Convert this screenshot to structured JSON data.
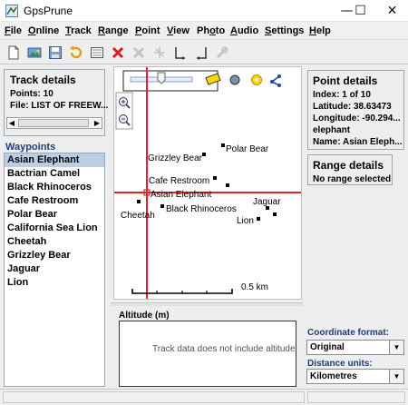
{
  "window": {
    "title": "GpsPrune",
    "minimize_glyph": "—",
    "maximize_glyph": "☐",
    "close_glyph": "✕"
  },
  "menu": {
    "items": [
      {
        "label": "File",
        "mnemonic": "F",
        "rest": "ile"
      },
      {
        "label": "Online",
        "mnemonic": "O",
        "rest": "nline"
      },
      {
        "label": "Track",
        "mnemonic": "T",
        "rest": "rack"
      },
      {
        "label": "Range",
        "mnemonic": "R",
        "rest": "ange"
      },
      {
        "label": "Point",
        "mnemonic": "P",
        "rest": "oint"
      },
      {
        "label": "View",
        "mnemonic": "V",
        "rest": "iew"
      },
      {
        "label": "Photo",
        "mnemonic": "o",
        "pre": "Ph",
        "rest": "to"
      },
      {
        "label": "Audio",
        "mnemonic": "A",
        "rest": "udio"
      },
      {
        "label": "Settings",
        "mnemonic": "S",
        "rest": "ettings"
      },
      {
        "label": "Help",
        "mnemonic": "H",
        "rest": "elp"
      }
    ]
  },
  "toolbar": {
    "icons": [
      "new-file-icon",
      "open-photo-icon",
      "save-icon",
      "undo-icon",
      "edit-point-icon",
      "delete-point-icon",
      "delete-range-icon",
      "crop-icon",
      "set-range-start-icon",
      "set-range-end-icon",
      "connect-icon"
    ]
  },
  "track": {
    "title": "Track details",
    "points_line": "Points: 10",
    "file_line": "File: LIST OF FREEW..."
  },
  "waypoints": {
    "title": "Waypoints",
    "items": [
      "Asian Elephant",
      "Bactrian Camel",
      "Black Rhinoceros",
      "Cafe Restroom",
      "Polar Bear",
      "California Sea Lion",
      "Cheetah",
      "Grizzley Bear",
      "Jaguar",
      "Lion"
    ],
    "selected": "Asian Elephant"
  },
  "map": {
    "labels": [
      "Polar Bear",
      "Grizzley Bear",
      "Cafe Restroom",
      "Asian Elephant",
      "Black Rhinoceros",
      "Cheetah",
      "Jaguar",
      "Lion"
    ],
    "scale_label": "0.5 km",
    "accent_color": "#e0242a"
  },
  "altitude": {
    "title": "Altitude (m)",
    "message": "Track data does not include altitude"
  },
  "point": {
    "title": "Point details",
    "index": "Index: 1 of 10",
    "latitude": "Latitude: 38.63473",
    "longitude": "Longitude: -90.294...",
    "extra": "elephant",
    "name": "Name: Asian Eleph..."
  },
  "range": {
    "title": "Range details",
    "status": "No range selected"
  },
  "coordinate_format": {
    "label": "Coordinate format:",
    "value": "Original"
  },
  "distance_units": {
    "label": "Distance units:",
    "value": "Kilometres"
  }
}
